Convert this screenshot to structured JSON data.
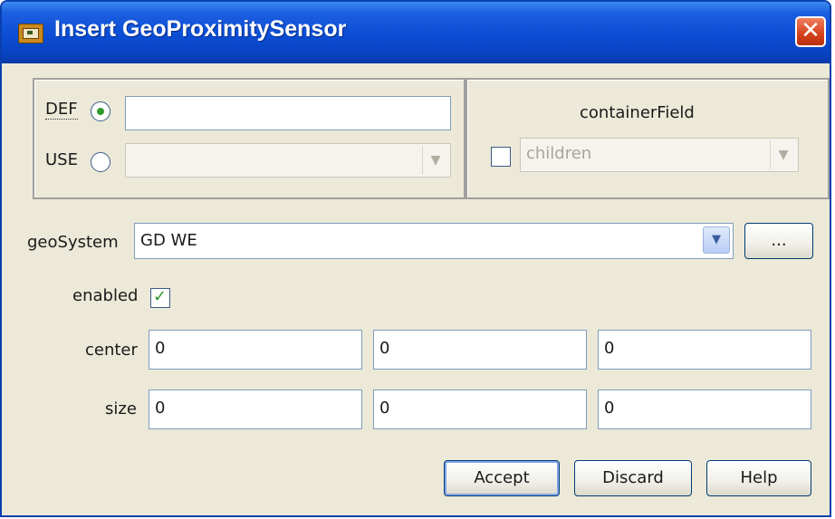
{
  "window": {
    "title": "Insert GeoProximitySensor",
    "close_glyph": "✕"
  },
  "node": {
    "def_label": "DEF",
    "def_value": "",
    "def_selected": true,
    "use_label": "USE",
    "use_value": "",
    "use_selected": false
  },
  "container": {
    "label": "containerField",
    "checked": false,
    "value": "children"
  },
  "geoSystem": {
    "label": "geoSystem",
    "value": "GD WE",
    "browse_label": "..."
  },
  "enabled": {
    "label": "enabled",
    "checked": true
  },
  "center": {
    "label": "center",
    "values": [
      "0",
      "0",
      "0"
    ]
  },
  "size": {
    "label": "size",
    "values": [
      "0",
      "0",
      "0"
    ]
  },
  "buttons": {
    "accept": "Accept",
    "discard": "Discard",
    "help": "Help"
  },
  "icons": {
    "window": "x3d-window-icon",
    "close": "close-icon",
    "dropdown": "chevron-down-icon"
  },
  "colors": {
    "titlebar": "#0a4dd4",
    "accent_green": "#2e9b2e",
    "close": "#d4401c",
    "dialog_bg": "#ece9d8"
  }
}
